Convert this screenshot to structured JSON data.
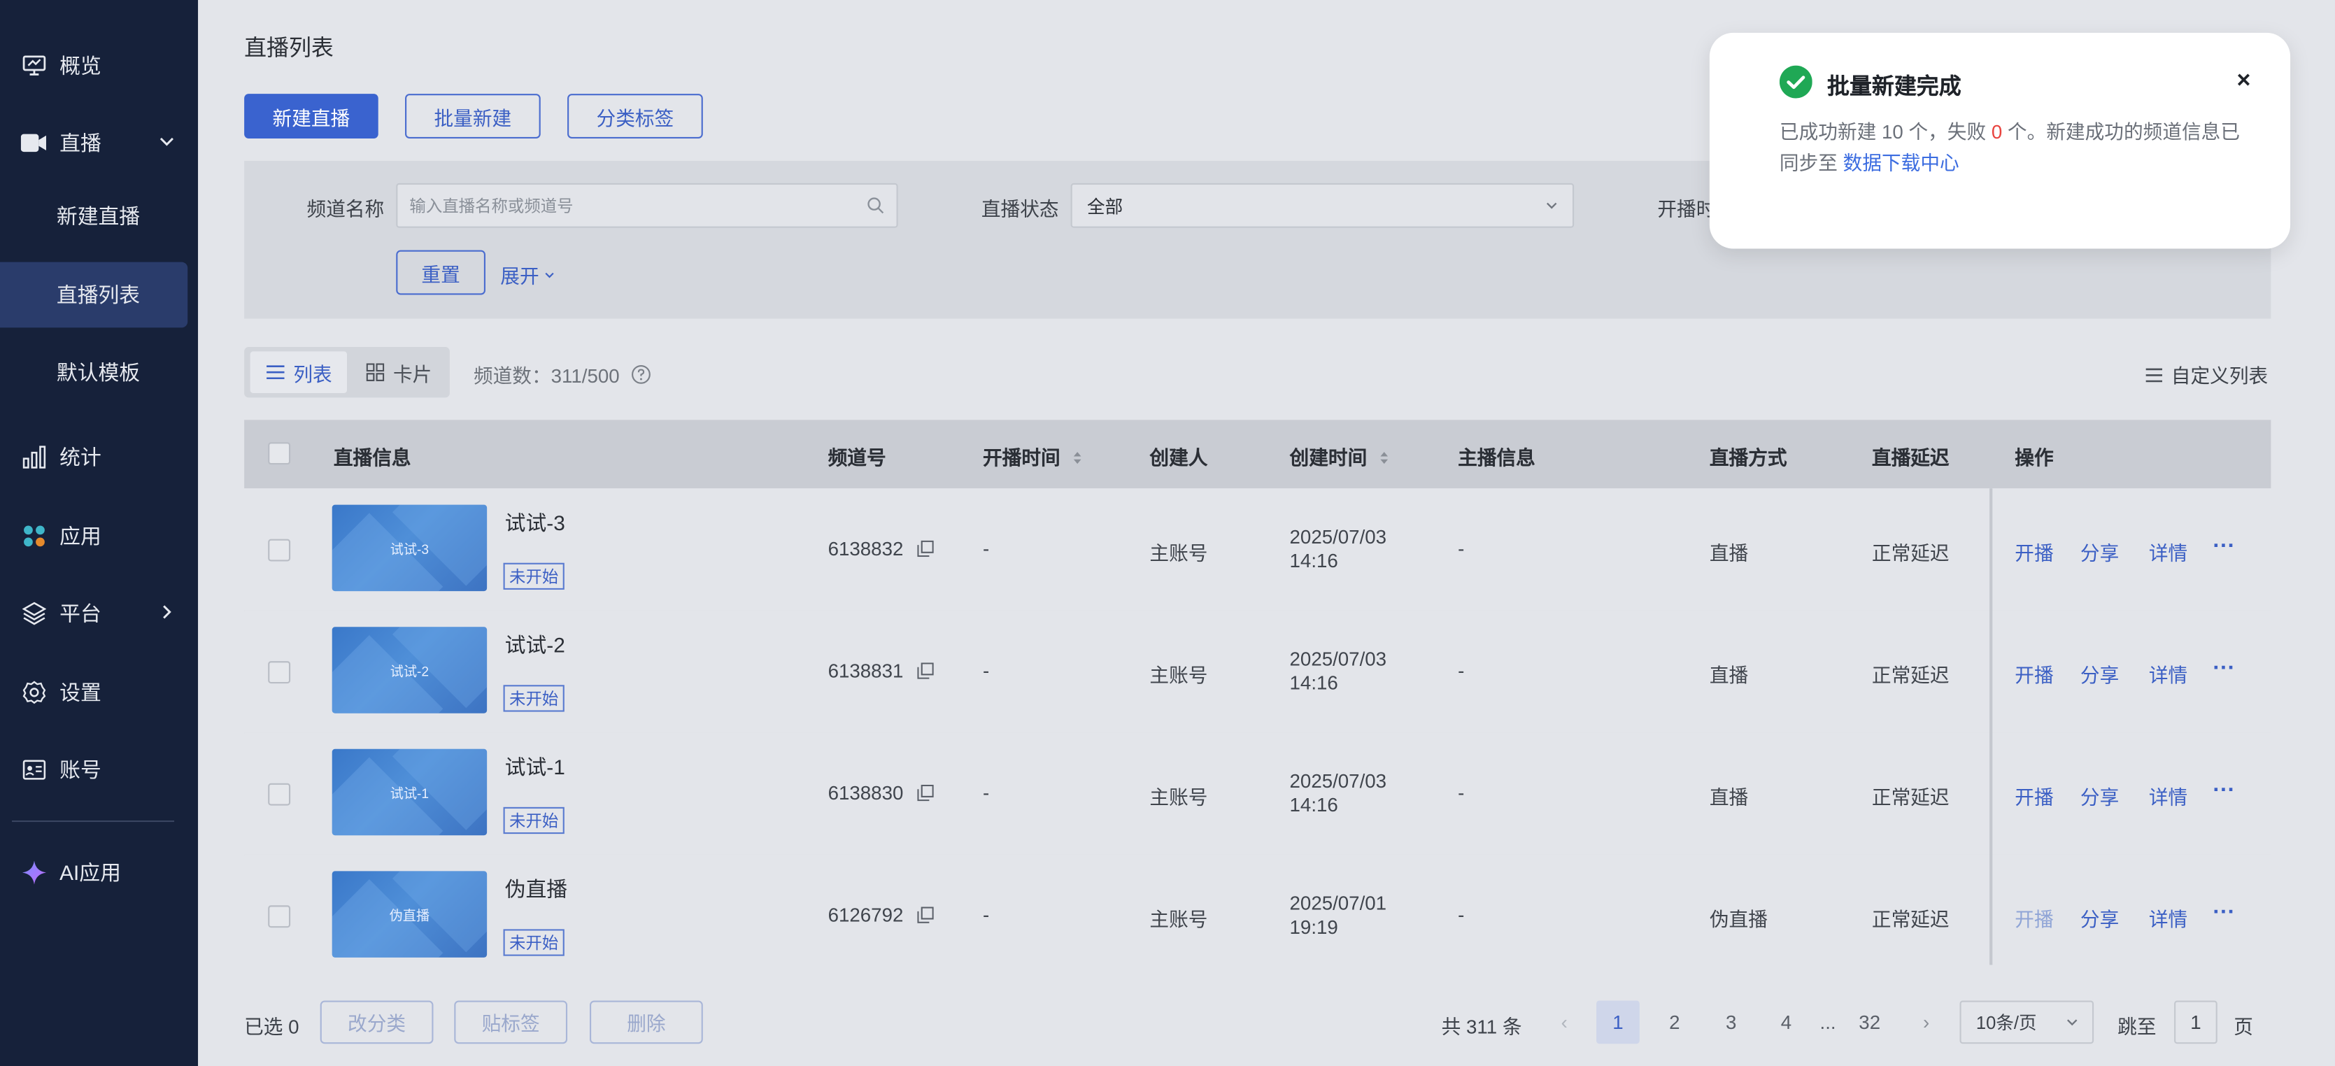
{
  "sidebar": {
    "items": [
      {
        "label": "概览",
        "icon": "monitor-icon"
      },
      {
        "label": "直播",
        "icon": "video-camera-icon"
      },
      {
        "label": "统计",
        "icon": "bar-chart-icon"
      },
      {
        "label": "应用",
        "icon": "apps-icon"
      },
      {
        "label": "平台",
        "icon": "layers-icon"
      },
      {
        "label": "设置",
        "icon": "gear-icon"
      },
      {
        "label": "账号",
        "icon": "id-card-icon"
      },
      {
        "label": "AI应用",
        "icon": "sparkle-icon"
      }
    ],
    "sub_items": [
      {
        "label": "新建直播"
      },
      {
        "label": "直播列表"
      },
      {
        "label": "默认模板"
      }
    ]
  },
  "page": {
    "title": "直播列表",
    "buttons": {
      "new": "新建直播",
      "batch": "批量新建",
      "category": "分类标签"
    }
  },
  "filters": {
    "channel_name_label": "频道名称",
    "channel_name_placeholder": "输入直播名称或频道号",
    "status_label": "直播状态",
    "status_value": "全部",
    "start_time_label": "开播时间",
    "reset": "重置",
    "expand": "展开"
  },
  "view": {
    "list": "列表",
    "card": "卡片",
    "channel_count": "频道数：311/500",
    "custom_columns": "自定义列表"
  },
  "table": {
    "headers": [
      "直播信息",
      "频道号",
      "开播时间",
      "创建人",
      "创建时间",
      "主播信息",
      "直播方式",
      "直播延迟",
      "操作"
    ],
    "rows": [
      {
        "name": "试试-3",
        "thumb": "试试-3",
        "status": "未开始",
        "channel": "6138832",
        "start": "-",
        "creator": "主账号",
        "created_date": "2025/07/03",
        "created_time": "14:16",
        "host": "-",
        "mode": "直播",
        "delay": "正常延迟"
      },
      {
        "name": "试试-2",
        "thumb": "试试-2",
        "status": "未开始",
        "channel": "6138831",
        "start": "-",
        "creator": "主账号",
        "created_date": "2025/07/03",
        "created_time": "14:16",
        "host": "-",
        "mode": "直播",
        "delay": "正常延迟"
      },
      {
        "name": "试试-1",
        "thumb": "试试-1",
        "status": "未开始",
        "channel": "6138830",
        "start": "-",
        "creator": "主账号",
        "created_date": "2025/07/03",
        "created_time": "14:16",
        "host": "-",
        "mode": "直播",
        "delay": "正常延迟"
      },
      {
        "name": "伪直播",
        "thumb": "伪直播",
        "status": "未开始",
        "channel": "6126792",
        "start": "-",
        "creator": "主账号",
        "created_date": "2025/07/01",
        "created_time": "19:19",
        "host": "-",
        "mode": "伪直播",
        "delay": "正常延迟"
      }
    ],
    "actions": {
      "start": "开播",
      "share": "分享",
      "detail": "详情",
      "more": "···"
    }
  },
  "footer": {
    "selected": "已选 0",
    "recategorize": "改分类",
    "tag": "贴标签",
    "delete": "删除",
    "total": "共 311 条",
    "pages": [
      "1",
      "2",
      "3",
      "4",
      "...",
      "32"
    ],
    "page_size": "10条/页",
    "jump_label": "跳至",
    "jump_value": "1",
    "page_unit": "页"
  },
  "toast": {
    "title": "批量新建完成",
    "body_prefix": "已成功新建 10 个，失败 ",
    "fail_count": "0",
    "body_suffix": " 个。新建成功的频道信息已同步至 ",
    "link": "数据下载中心",
    "close": "×",
    "success_color": "#1fa855"
  }
}
